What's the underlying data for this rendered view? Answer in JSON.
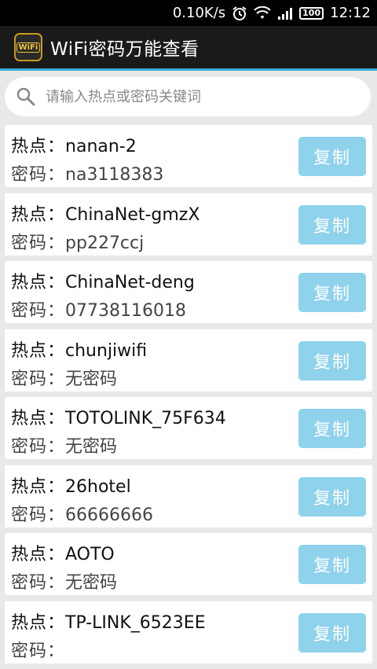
{
  "status": {
    "speed": "0.10K/s",
    "battery": "100",
    "time": "12:12"
  },
  "app": {
    "icon_text": "WiFi",
    "title": "WiFi密码万能查看"
  },
  "search": {
    "placeholder": "请输入热点或密码关键词",
    "value": ""
  },
  "labels": {
    "hotspot": "热点：",
    "password": "密码：",
    "copy": "复制"
  },
  "items": [
    {
      "ssid": "nanan-2",
      "password": "na3118383"
    },
    {
      "ssid": "ChinaNet-gmzX",
      "password": "pp227ccj"
    },
    {
      "ssid": "ChinaNet-deng",
      "password": "07738116018"
    },
    {
      "ssid": "chunjiwifi",
      "password": "无密码"
    },
    {
      "ssid": "TOTOLINK_75F634",
      "password": "无密码"
    },
    {
      "ssid": "26hotel",
      "password": "66666666"
    },
    {
      "ssid": "AOTO",
      "password": "无密码"
    },
    {
      "ssid": "TP-LINK_6523EE",
      "password": ""
    }
  ]
}
